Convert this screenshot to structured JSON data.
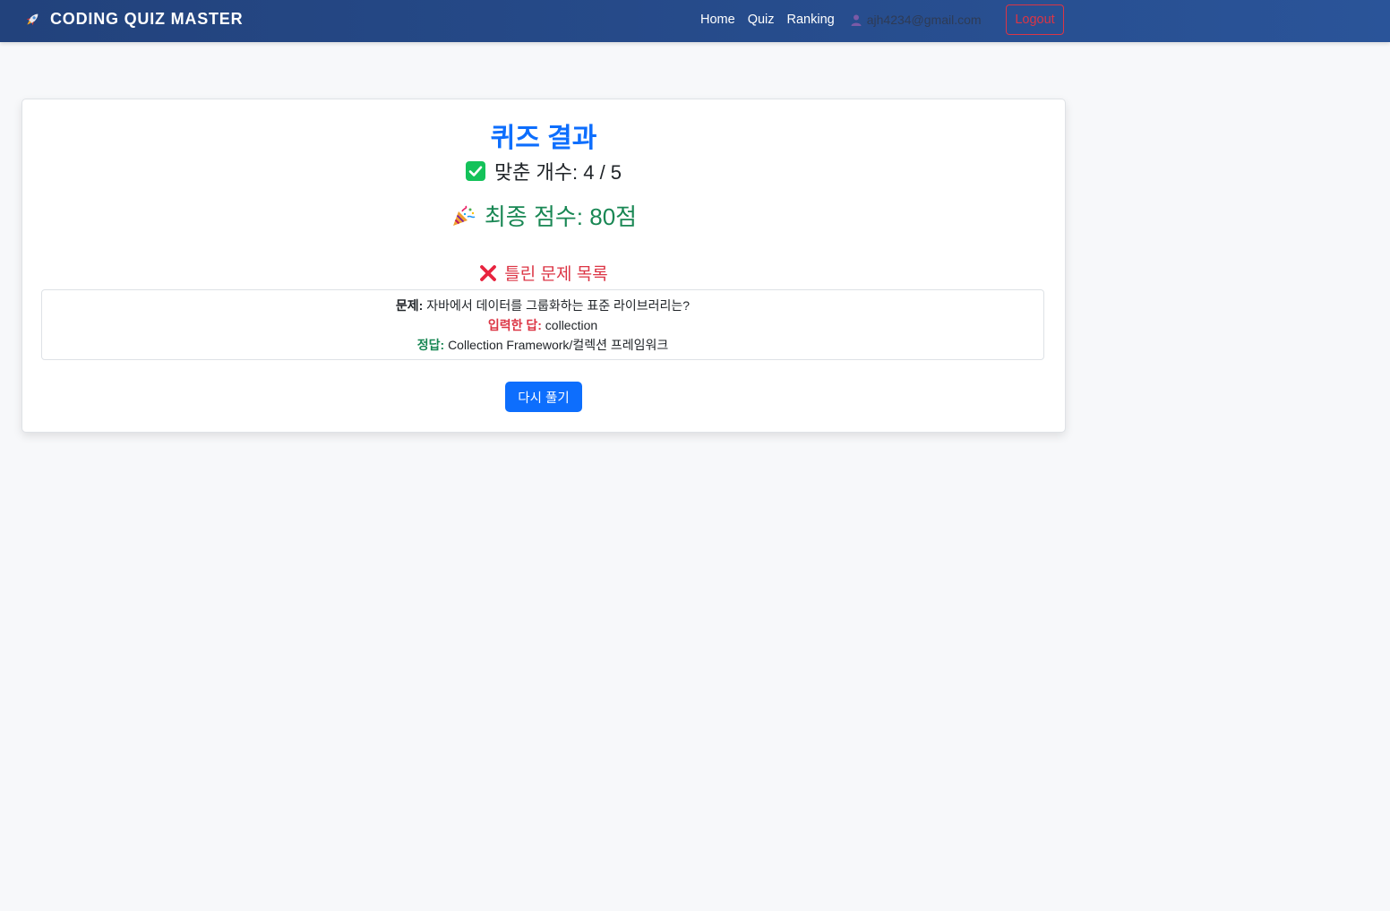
{
  "navbar": {
    "brand": "CODING QUIZ MASTER",
    "links": [
      "Home",
      "Quiz",
      "Ranking"
    ],
    "user_email": "ajh4234@gmail.com",
    "logout_label": "Logout"
  },
  "result": {
    "title": "퀴즈 결과",
    "correct_count": "맞춘 개수: 4 / 5",
    "final_score": "최종 점수: 80점",
    "wrong_heading": "틀린 문제 목록",
    "wrong_items": [
      {
        "question_label": "문제:",
        "question": "자바에서 데이터를 그룹화하는 표준 라이브러리는?",
        "input_label": "입력한 답:",
        "input": "collection",
        "answer_label": "정답:",
        "answer": "Collection Framework/컬렉션 프레임워크"
      }
    ],
    "retry_label": "다시 풀기"
  },
  "icons": {
    "brand": "rocket-icon",
    "user": "user-icon",
    "correct": "check-mark-icon",
    "score": "party-popper-icon",
    "wrong": "cross-mark-icon"
  },
  "colors": {
    "navbar_start": "#22427c",
    "navbar_end": "#2a5499",
    "primary": "#0d6efd",
    "success": "#198754",
    "danger": "#dc3545",
    "background": "#f7f8fa"
  }
}
